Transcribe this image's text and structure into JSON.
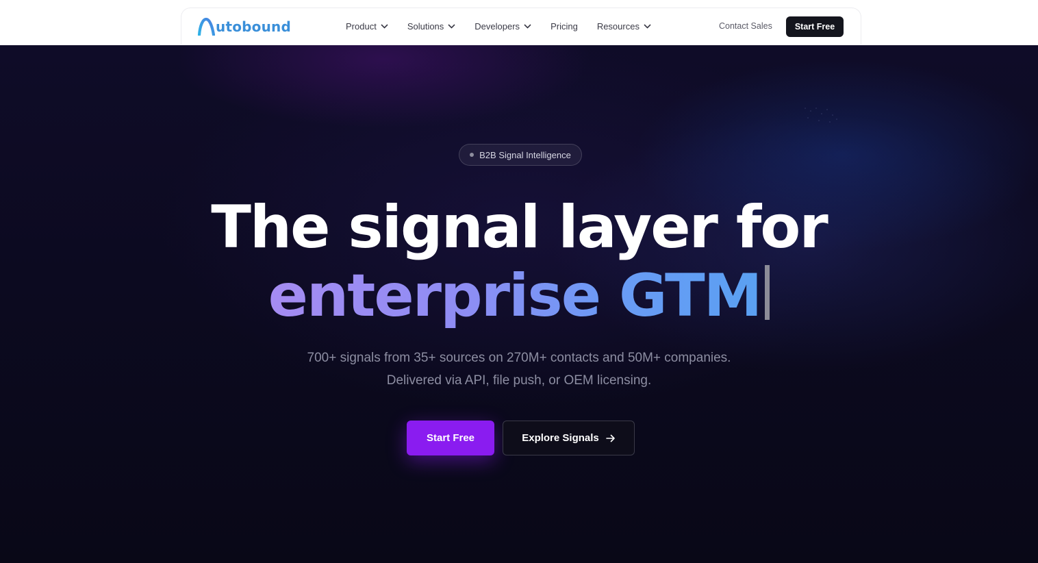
{
  "header": {
    "logo_text": "utobound",
    "nav": [
      {
        "label": "Product",
        "has_dropdown": true
      },
      {
        "label": "Solutions",
        "has_dropdown": true
      },
      {
        "label": "Developers",
        "has_dropdown": true
      },
      {
        "label": "Pricing",
        "has_dropdown": false
      },
      {
        "label": "Resources",
        "has_dropdown": true
      }
    ],
    "contact_label": "Contact Sales",
    "start_label": "Start Free"
  },
  "hero": {
    "badge": "B2B Signal Intelligence",
    "headline_line1": "The signal layer for",
    "headline_line2": "enterprise GTM",
    "subtext_line1": "700+ signals from 35+ sources on 270M+ contacts and 50M+ companies.",
    "subtext_line2": "Delivered via API, file push, or OEM licensing.",
    "primary_cta": "Start Free",
    "secondary_cta": "Explore Signals"
  },
  "colors": {
    "brand_blue": "#3a8fd9",
    "cta_purple": "#8a1cf0",
    "hero_bg": "#0c0a20",
    "dark_button": "#14151d"
  },
  "icons": {
    "logo": "arch-a-logo-icon",
    "dropdown": "chevron-down-icon",
    "arrow": "arrow-right-icon"
  }
}
